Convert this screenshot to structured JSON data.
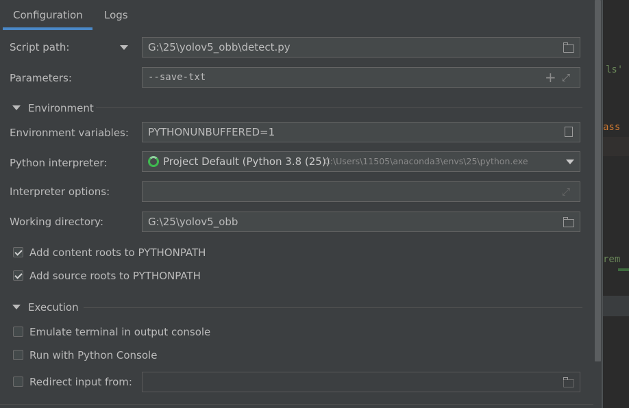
{
  "tabs": [
    {
      "label": "Configuration",
      "active": true
    },
    {
      "label": "Logs",
      "active": false
    }
  ],
  "script_path": {
    "label": "Script path:",
    "value": "G:\\25\\yolov5_obb\\detect.py",
    "icon": "folder-icon"
  },
  "parameters": {
    "label": "Parameters:",
    "value": "--save-txt",
    "icons": [
      "plus-icon",
      "expand-icon"
    ]
  },
  "environment": {
    "title": "Environment",
    "env_vars": {
      "label": "Environment variables:",
      "value": "PYTHONUNBUFFERED=1",
      "icon": "clipboard-icon"
    },
    "interpreter": {
      "label": "Python interpreter:",
      "value": "Project Default (Python 3.8 (25))",
      "path": "C:\\Users\\11505\\anaconda3\\envs\\25\\python.exe",
      "icon": "loading-ring-icon"
    },
    "interpreter_options": {
      "label": "Interpreter options:",
      "value": ""
    },
    "working_dir": {
      "label": "Working directory:",
      "value": "G:\\25\\yolov5_obb"
    },
    "content_roots": {
      "label": "Add content roots to PYTHONPATH",
      "checked": true
    },
    "source_roots": {
      "label": "Add source roots to PYTHONPATH",
      "checked": true
    }
  },
  "execution": {
    "title": "Execution",
    "emulate_terminal": {
      "label": "Emulate terminal in output console",
      "checked": false
    },
    "python_console": {
      "label": "Run with Python Console",
      "checked": false
    },
    "redirect_input": {
      "label": "Redirect input from:",
      "checked": false,
      "value": ""
    }
  },
  "editor_fragments": [
    "ls'",
    "ass",
    "rem"
  ],
  "colors": {
    "background": "#3c3f41",
    "field": "#45494a",
    "accent": "#4a88c7",
    "spinner": "#3fb950"
  }
}
